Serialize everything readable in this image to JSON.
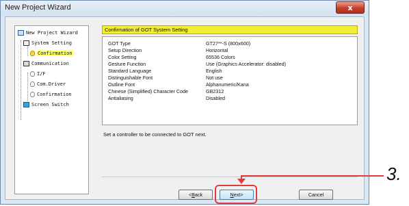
{
  "window": {
    "title": "New Project Wizard",
    "close_glyph": "x"
  },
  "nav_tree": {
    "items": [
      {
        "label": "New Project Wizard",
        "icon": "wizard-icon"
      },
      {
        "label": "System Setting",
        "icon": "system-icon"
      },
      {
        "label": "Confirmation",
        "icon": "bulb-icon",
        "selected": true
      },
      {
        "label": "Communication",
        "icon": "communication-icon"
      },
      {
        "label": "I/F",
        "icon": "bulb-icon"
      },
      {
        "label": "Com.Driver",
        "icon": "bulb-icon"
      },
      {
        "label": "Confirmation",
        "icon": "bulb-icon"
      },
      {
        "label": "Screen Switch",
        "icon": "screen-icon"
      }
    ]
  },
  "heading": "Confirmation of GOT System Setting",
  "settings": [
    {
      "key": "GOT Type",
      "value": "GT27**-S (800x600)"
    },
    {
      "key": "Setup Direction",
      "value": "Horizontal"
    },
    {
      "key": "Color Setting",
      "value": "65536 Colors"
    },
    {
      "key": "Gesture Function",
      "value": "Use (Graphics Accelerator: disabled)"
    },
    {
      "key": "Standard Language",
      "value": "English"
    },
    {
      "key": "Distinguishable Font",
      "value": "Not use"
    },
    {
      "key": "Outline Font",
      "value": "Alphanumeric/Kana"
    },
    {
      "key": "Chinese (Simplified) Character Code",
      "value": "GB2312"
    },
    {
      "key": "Antialiasing",
      "value": "Disabled"
    }
  ],
  "message": "Set a controller to be connected to GOT next.",
  "buttons": {
    "back": {
      "prefix": "< ",
      "mnemonic": "B",
      "rest": "ack"
    },
    "next": {
      "mnemonic": "N",
      "rest": "ext",
      "suffix": " >"
    },
    "cancel": "Cancel"
  },
  "annotation": {
    "step": "3."
  },
  "colors": {
    "heading_bg": "#f2ee34",
    "highlight": "#e23b3b",
    "selected_bg": "#ffff66"
  }
}
